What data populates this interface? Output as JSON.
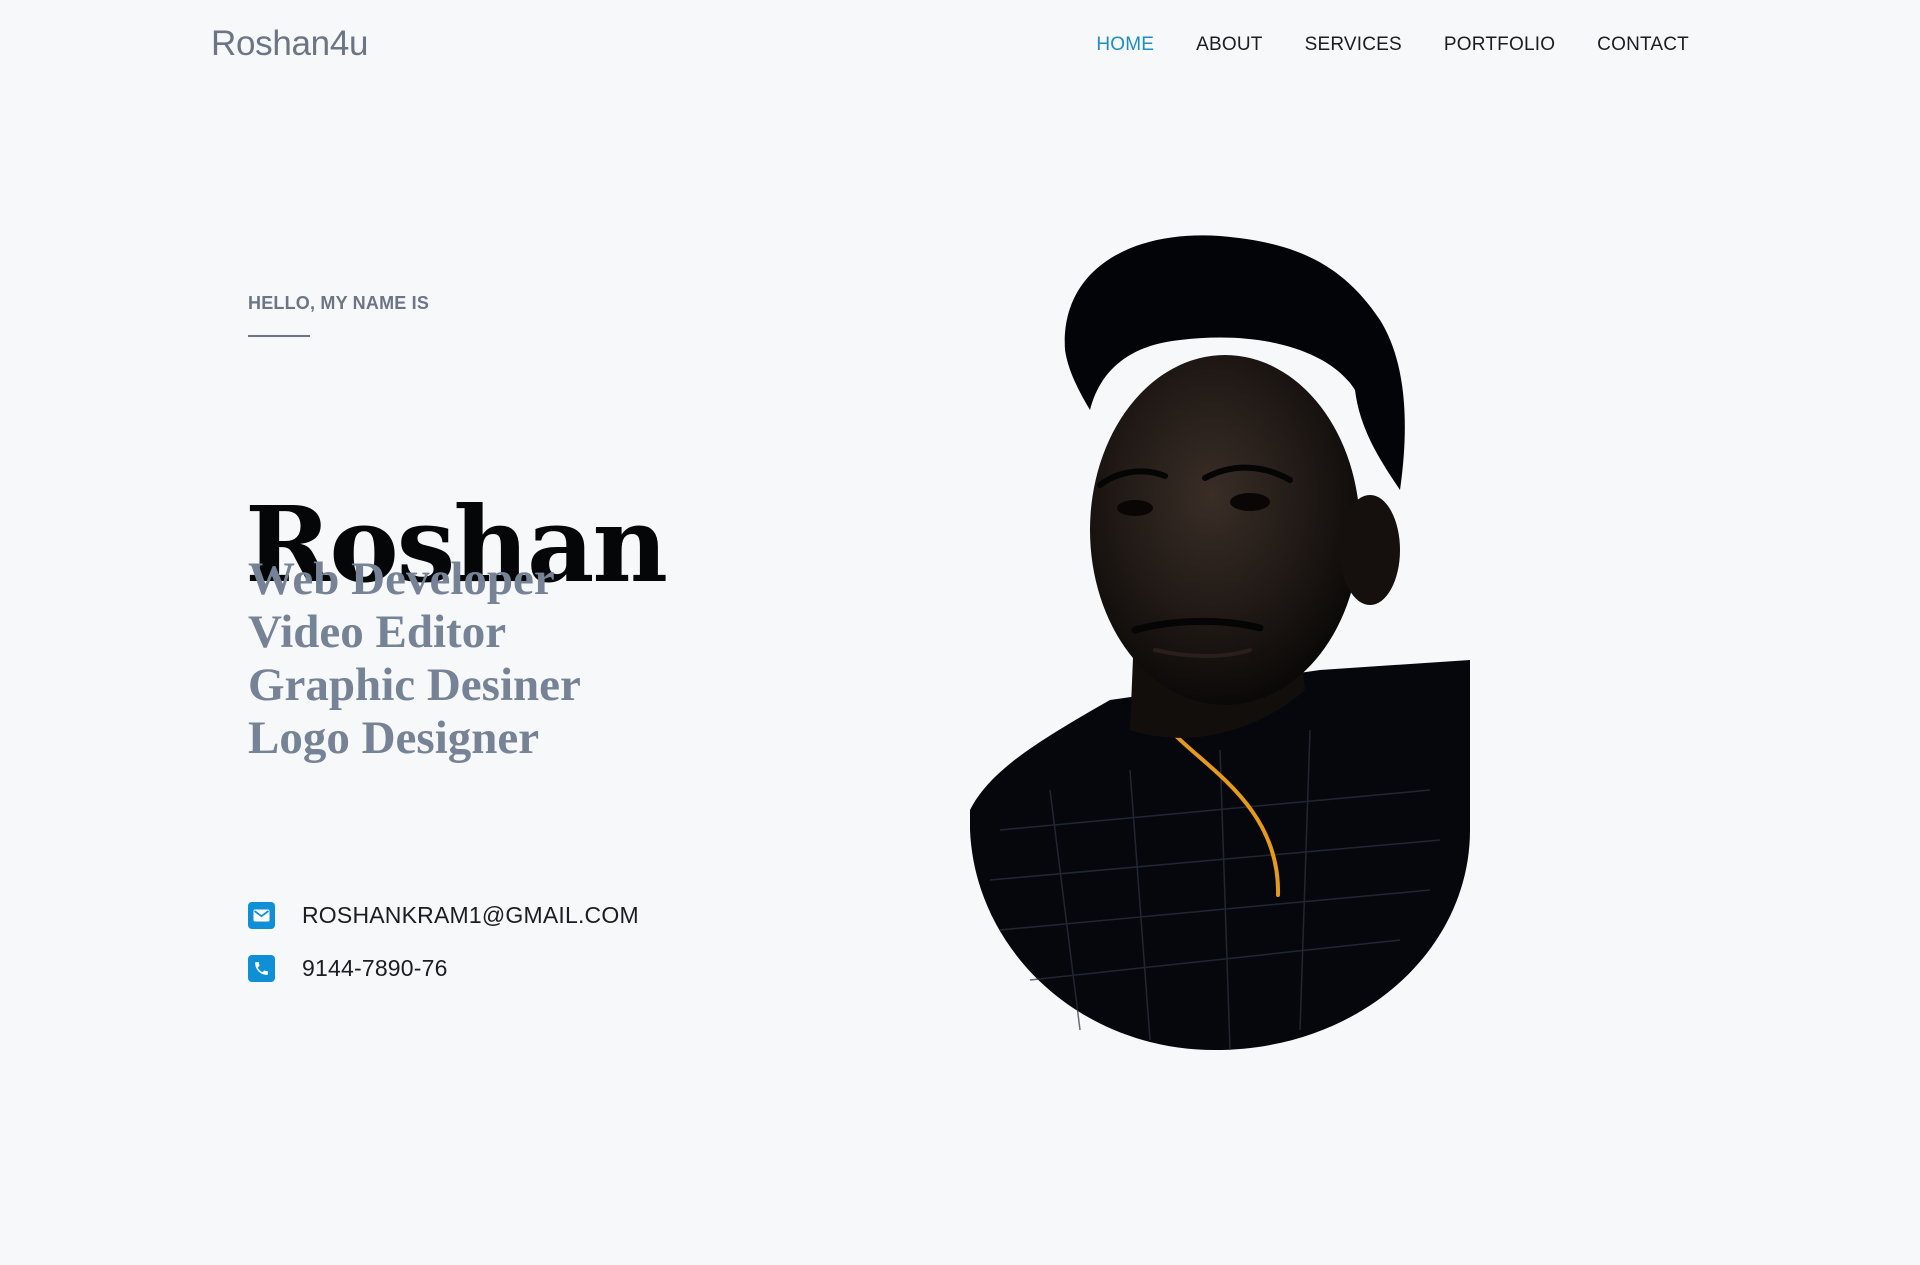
{
  "brand": {
    "name": "Roshan4u"
  },
  "nav": {
    "items": [
      {
        "label": "HOME"
      },
      {
        "label": "ABOUT"
      },
      {
        "label": "SERVICES"
      },
      {
        "label": "PORTFOLIO"
      },
      {
        "label": "CONTACT"
      }
    ],
    "active_item": "HOME"
  },
  "hero": {
    "greeting": "HELLO, MY NAME IS",
    "name": "Roshan",
    "roles": [
      "Web Developer",
      "Video Editor",
      "Graphic Desiner",
      "Logo Designer"
    ]
  },
  "contact": {
    "email": "ROSHANKRAM1@GMAIL.COM",
    "phone": "9144-7890-76",
    "email_icon": "envelope-icon",
    "phone_icon": "phone-icon"
  },
  "colors": {
    "background": "#f7f8fa",
    "accent": "#1e8cc8",
    "muted": "#6b7585",
    "role_text": "#768396",
    "dark": "#050608"
  }
}
